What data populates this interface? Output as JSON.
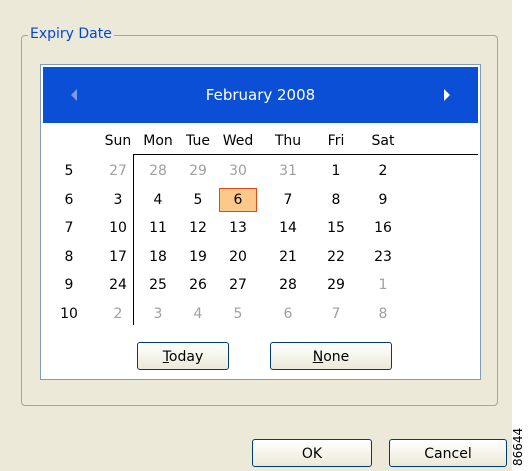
{
  "group_title": "Expiry Date",
  "calendar": {
    "month_title": "February 2008",
    "weekdays": [
      "Sun",
      "Mon",
      "Tue",
      "Wed",
      "Thu",
      "Fri",
      "Sat"
    ],
    "weeks": [
      {
        "number": "5",
        "days": [
          {
            "d": "27",
            "other": true
          },
          {
            "d": "28",
            "other": true
          },
          {
            "d": "29",
            "other": true
          },
          {
            "d": "30",
            "other": true
          },
          {
            "d": "31",
            "other": true
          },
          {
            "d": "1"
          },
          {
            "d": "2"
          }
        ]
      },
      {
        "number": "6",
        "days": [
          {
            "d": "3"
          },
          {
            "d": "4"
          },
          {
            "d": "5"
          },
          {
            "d": "6",
            "today": true
          },
          {
            "d": "7"
          },
          {
            "d": "8"
          },
          {
            "d": "9"
          }
        ]
      },
      {
        "number": "7",
        "days": [
          {
            "d": "10"
          },
          {
            "d": "11"
          },
          {
            "d": "12"
          },
          {
            "d": "13"
          },
          {
            "d": "14"
          },
          {
            "d": "15"
          },
          {
            "d": "16"
          }
        ]
      },
      {
        "number": "8",
        "days": [
          {
            "d": "17"
          },
          {
            "d": "18"
          },
          {
            "d": "19"
          },
          {
            "d": "20"
          },
          {
            "d": "21"
          },
          {
            "d": "22"
          },
          {
            "d": "23"
          }
        ]
      },
      {
        "number": "9",
        "days": [
          {
            "d": "24"
          },
          {
            "d": "25"
          },
          {
            "d": "26"
          },
          {
            "d": "27"
          },
          {
            "d": "28"
          },
          {
            "d": "29"
          },
          {
            "d": "1",
            "other": true
          }
        ]
      },
      {
        "number": "10",
        "days": [
          {
            "d": "2",
            "other": true
          },
          {
            "d": "3",
            "other": true
          },
          {
            "d": "4",
            "other": true
          },
          {
            "d": "5",
            "other": true
          },
          {
            "d": "6",
            "other": true
          },
          {
            "d": "7",
            "other": true
          },
          {
            "d": "8",
            "other": true
          }
        ]
      }
    ],
    "today_button": {
      "accel": "T",
      "rest": "oday"
    },
    "none_button": {
      "accel": "N",
      "rest": "one"
    },
    "prev_icon": "triangle-left-icon",
    "next_icon": "triangle-right-icon"
  },
  "dialog": {
    "ok_label": "OK",
    "cancel_label": "Cancel"
  },
  "side_label": "86644",
  "colors": {
    "header_bg": "#0b4fd6",
    "today_fill": "#fcc98a",
    "today_border": "#e04a1b",
    "group_title": "#0046d5"
  }
}
